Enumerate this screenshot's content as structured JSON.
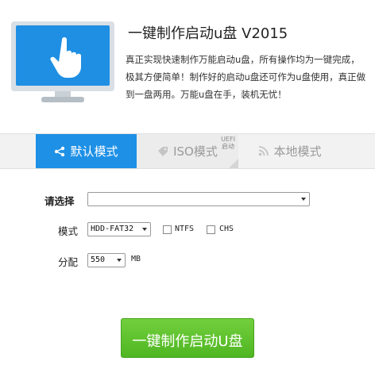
{
  "header": {
    "title": "一键制作启动u盘 V2015",
    "description": "真正实现快速制作万能启动u盘，所有操作均为一键完成，极其方便简单！制作好的启动u盘还可作为u盘使用，真正做到一盘两用。万能u盘在手，装机无忧！",
    "hero_icon": "monitor-hand-pointer-icon"
  },
  "tabs": [
    {
      "label": "默认模式",
      "icon": "share-icon",
      "active": true
    },
    {
      "label": "ISO模式",
      "icon": "tag-icon",
      "badge": "UEFI启动",
      "active": false
    },
    {
      "label": "本地模式",
      "icon": "rss-icon",
      "active": false
    }
  ],
  "form": {
    "select_label": "请选择",
    "select_value": "",
    "mode_label": "模式",
    "mode_value": "HDD-FAT32",
    "ntfs_label": "NTFS",
    "chs_label": "CHS",
    "alloc_label": "分配",
    "alloc_value": "550",
    "alloc_unit": "MB"
  },
  "actions": {
    "make_button": "一键制作启动U盘"
  },
  "colors": {
    "accent": "#1e90e6",
    "button_green": "#5cbf2a"
  }
}
